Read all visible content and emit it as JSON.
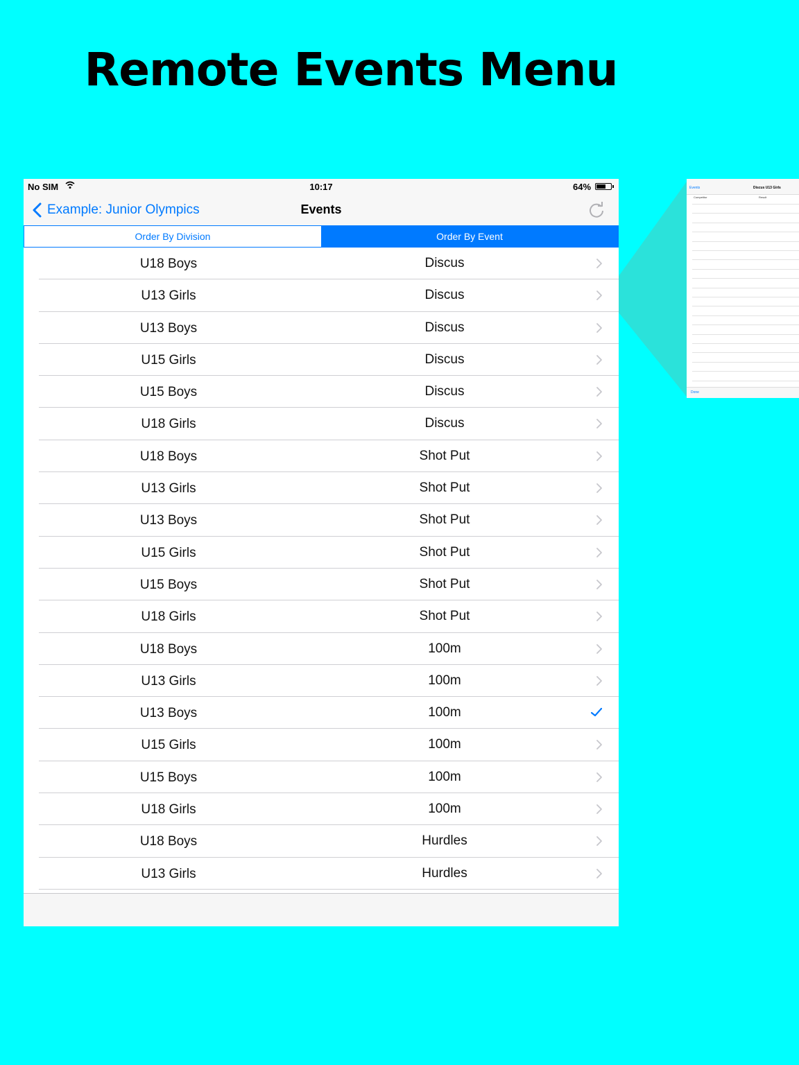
{
  "headline": "Remote Events Menu",
  "status_bar": {
    "carrier": "No SIM",
    "time": "10:17",
    "battery": "64%",
    "battery_level": 0.64
  },
  "nav": {
    "back_label": "Example: Junior Olympics",
    "title": "Events"
  },
  "segments": [
    {
      "label": "Order By Division",
      "active": false
    },
    {
      "label": "Order By Event",
      "active": true
    }
  ],
  "rows": [
    {
      "division": "U18 Boys",
      "event": "Discus",
      "accessory": "chevron"
    },
    {
      "division": "U13 Girls",
      "event": "Discus",
      "accessory": "chevron"
    },
    {
      "division": "U13 Boys",
      "event": "Discus",
      "accessory": "chevron"
    },
    {
      "division": "U15 Girls",
      "event": "Discus",
      "accessory": "chevron"
    },
    {
      "division": "U15 Boys",
      "event": "Discus",
      "accessory": "chevron"
    },
    {
      "division": "U18 Girls",
      "event": "Discus",
      "accessory": "chevron"
    },
    {
      "division": "U18 Boys",
      "event": "Shot Put",
      "accessory": "chevron"
    },
    {
      "division": "U13 Girls",
      "event": "Shot Put",
      "accessory": "chevron"
    },
    {
      "division": "U13 Boys",
      "event": "Shot Put",
      "accessory": "chevron"
    },
    {
      "division": "U15 Girls",
      "event": "Shot Put",
      "accessory": "chevron"
    },
    {
      "division": "U15 Boys",
      "event": "Shot Put",
      "accessory": "chevron"
    },
    {
      "division": "U18 Girls",
      "event": "Shot Put",
      "accessory": "chevron"
    },
    {
      "division": "U18 Boys",
      "event": "100m",
      "accessory": "chevron"
    },
    {
      "division": "U13 Girls",
      "event": "100m",
      "accessory": "chevron"
    },
    {
      "division": "U13 Boys",
      "event": "100m",
      "accessory": "check"
    },
    {
      "division": "U15 Girls",
      "event": "100m",
      "accessory": "chevron"
    },
    {
      "division": "U15 Boys",
      "event": "100m",
      "accessory": "chevron"
    },
    {
      "division": "U18 Girls",
      "event": "100m",
      "accessory": "chevron"
    },
    {
      "division": "U18 Boys",
      "event": "Hurdles",
      "accessory": "chevron"
    },
    {
      "division": "U13 Girls",
      "event": "Hurdles",
      "accessory": "chevron"
    }
  ],
  "thumbnail": {
    "back_label": "Events",
    "title": "Discus U13 Girls",
    "col_competitor": "Competitor",
    "col_result": "Result",
    "done_label": "Done"
  },
  "colors": {
    "background": "#00ffff",
    "accent": "#007aff",
    "callout": "#2de0d8"
  },
  "icons": {
    "back": "chevron-left-icon",
    "refresh": "refresh-icon",
    "row": "chevron-right-icon",
    "selected": "checkmark-icon",
    "wifi": "wifi-icon",
    "battery": "battery-icon"
  }
}
